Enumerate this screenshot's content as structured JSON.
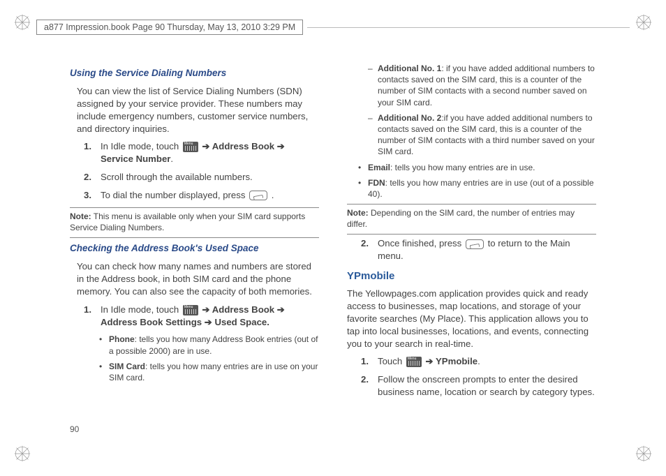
{
  "header": "a877 Impression.book  Page 90  Thursday, May 13, 2010  3:29 PM",
  "pageNumber": "90",
  "left": {
    "h1": "Using the Service Dialing Numbers",
    "p1": "You can view the list of Service Dialing Numbers (SDN) assigned by your service provider. These numbers may include emergency numbers, customer service numbers, and directory inquiries.",
    "s1_n": "1.",
    "s1_a": "In Idle mode, touch ",
    "s1_b": " ➔ Address Book ➔ Service Number",
    "s1_c": ".",
    "s2_n": "2.",
    "s2_t": "Scroll through the available numbers.",
    "s3_n": "3.",
    "s3_a": "To dial the number displayed, press ",
    "s3_b": " .",
    "note1_l": "Note:",
    "note1_t": " This menu is available only when your SIM card supports Service Dialing Numbers.",
    "h2": "Checking the Address Book's Used Space",
    "p2": "You can check how many names and numbers are stored in the Address book, in both SIM card and the phone memory. You can also see the capacity of both memories.",
    "s4_n": "1.",
    "s4_a": "In Idle mode, touch ",
    "s4_b": " ➔ Address Book ➔ Address Book Settings ➔ Used Space.",
    "b1_l": "Phone",
    "b1_t": ": tells you how many Address Book entries (out of a possible 2000) are in use.",
    "b2_l": "SIM Card",
    "b2_t": ": tells you how many entries are in use on your SIM card."
  },
  "right": {
    "sb1_l": "Additional No. 1",
    "sb1_t": ": if you have added additional numbers to contacts saved on the SIM card, this is a counter of the number of SIM contacts with a second number saved on your SIM card.",
    "sb2_l": "Additional No. 2",
    "sb2_t": ":if you have added additional numbers to contacts saved on the SIM card, this is a counter of the number of SIM contacts with a third number saved on your SIM card.",
    "b3_l": "Email",
    "b3_t": ": tells you how many entries are in use.",
    "b4_l": "FDN",
    "b4_t": ": tells you how many entries are in use (out of a possible 40).",
    "note2_l": "Note:",
    "note2_t": " Depending on the SIM card, the number of entries may differ.",
    "s5_n": "2.",
    "s5_a": "Once finished, press ",
    "s5_b": " to return to the Main menu.",
    "h3": "YPmobile",
    "p3": "The Yellowpages.com application provides quick and ready access to businesses, map locations, and storage of your favorite searches (My Place). This application allows you to tap into local businesses, locations, and events, connecting you to your search in real-time.",
    "s6_n": "1.",
    "s6_a": "Touch ",
    "s6_b": " ➔ YPmobile",
    "s6_c": ".",
    "s7_n": "2.",
    "s7_t": "Follow the onscreen prompts to enter the desired business name, location or search by category types."
  }
}
